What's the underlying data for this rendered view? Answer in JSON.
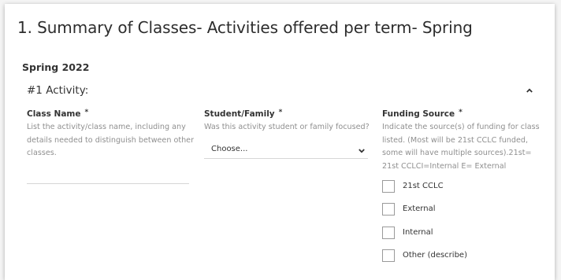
{
  "page": {
    "title": "1. Summary of Classes- Activities offered per term- Spring",
    "section_title": "Spring 2022"
  },
  "panel": {
    "title": "#1 Activity:",
    "toggle_icon": "chevron-up-icon"
  },
  "fields": {
    "class_name": {
      "label": "Class Name",
      "required_mark": "*",
      "help": "List the activity/class name, including any details needed to distinguish between other classes.",
      "value": ""
    },
    "student_family": {
      "label": "Student/Family",
      "required_mark": "*",
      "help": "Was this activity student or family focused?",
      "selected": "Choose..."
    },
    "funding_source": {
      "label": "Funding Source",
      "required_mark": "*",
      "help": "Indicate the source(s) of funding for class listed. (Most will be 21st CCLC funded, some will have multiple sources).21st= 21st CCLCI=Internal E= External",
      "options": [
        {
          "label": "21st CCLC",
          "checked": false
        },
        {
          "label": "External",
          "checked": false
        },
        {
          "label": "Internal",
          "checked": false
        },
        {
          "label": "Other (describe)",
          "checked": false
        }
      ]
    }
  },
  "colors": {
    "text": "#333333",
    "help_text": "#8f8f8f",
    "border": "#d6d6d6",
    "checkbox_border": "#9a9a9a"
  }
}
